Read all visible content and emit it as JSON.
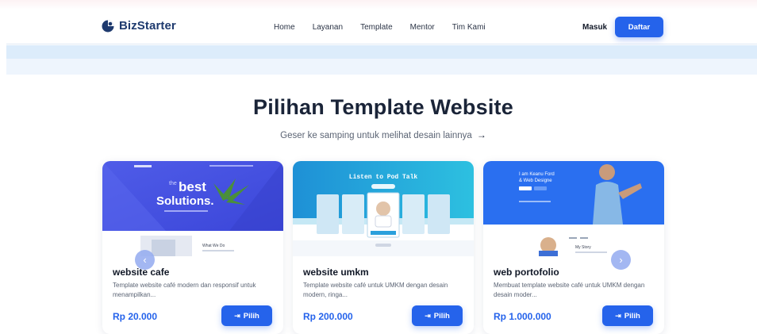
{
  "header": {
    "logo_text": "BizStarter",
    "logo_icon": "half-moon-logo",
    "menu": [
      "Home",
      "Layanan",
      "Template",
      "Mentor",
      "Tim Kami"
    ],
    "login_label": "Masuk",
    "register_label": "Daftar"
  },
  "section": {
    "title": "Pilihan Template Website",
    "subtitle": "Geser ke samping untuk melihat desain lainnya",
    "subtitle_icon": "arrow-right-icon"
  },
  "cards": [
    {
      "title": "website cafe",
      "description": "Template website café modern dan responsif untuk menampilkan...",
      "price": "Rp 20.000",
      "button": "Pilih",
      "preview": {
        "headline_small": "the",
        "headline_big": "best",
        "headline_2": "Solutions.",
        "section_label": "What We Do"
      }
    },
    {
      "title": "website umkm",
      "description": "Template website café untuk UMKM dengan desain modern, ringa...",
      "price": "Rp 200.000",
      "button": "Pilih",
      "preview": {
        "headline": "Listen to Pod Talk"
      }
    },
    {
      "title": "web portofolio",
      "description": "Membuat template website café untuk UMKM dengan desain moder...",
      "price": "Rp 1.000.000",
      "button": "Pilih",
      "preview": {
        "headline_1": "I am Keanu Ford",
        "headline_2": "& Web Designe",
        "section_label": "My Story"
      }
    }
  ],
  "colors": {
    "accent": "#2563eb",
    "heading": "#1a2438",
    "band": "#dcecfb"
  }
}
